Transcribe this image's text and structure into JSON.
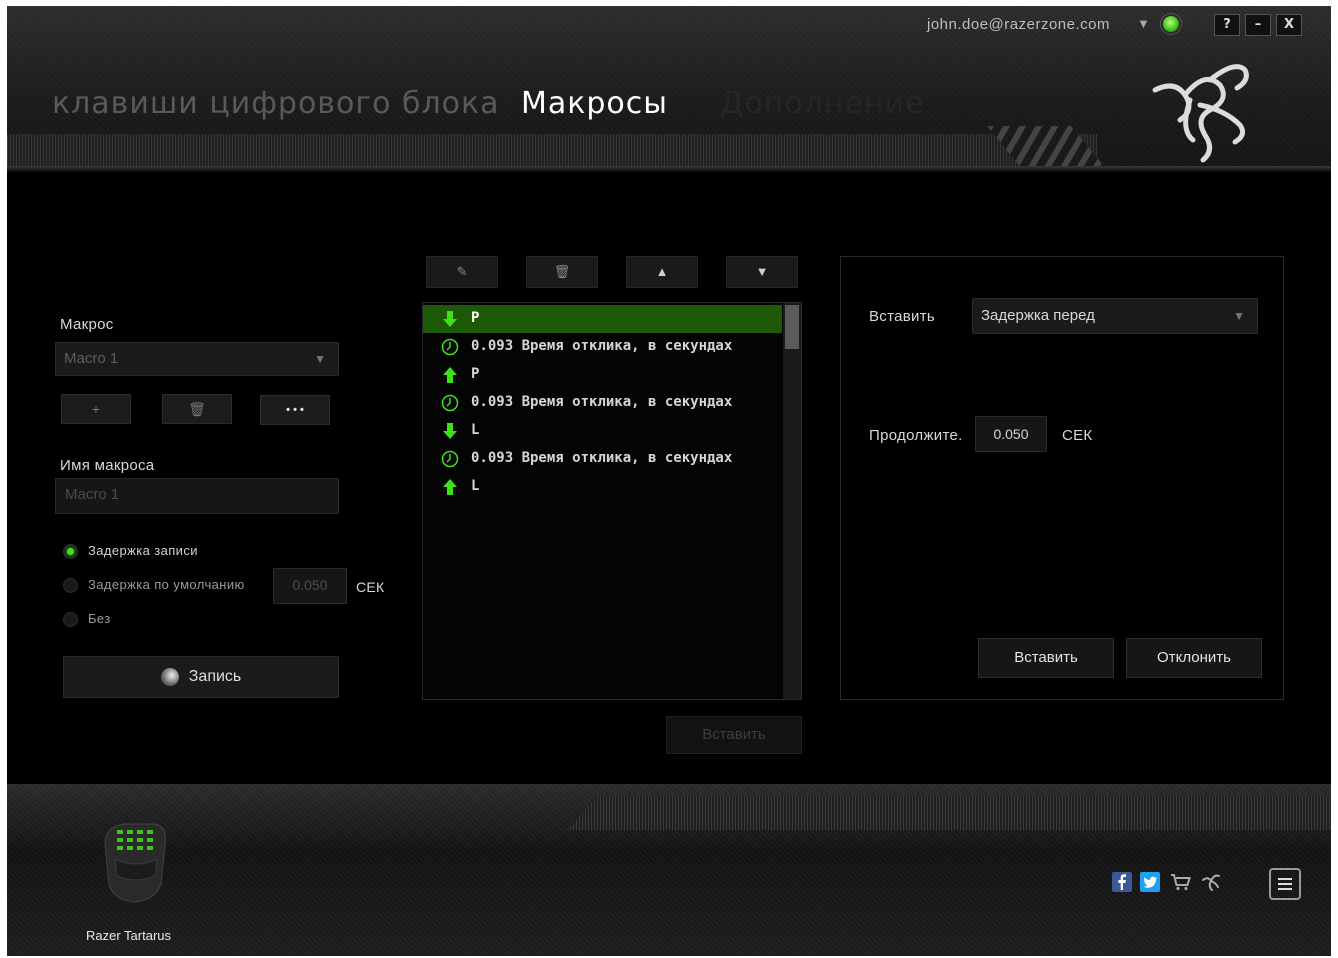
{
  "header": {
    "user_email": "john.doe@razerzone.com",
    "window_buttons": {
      "help": "?",
      "minimize": "–",
      "close": "X"
    },
    "tabs": [
      {
        "label": "клавиши цифрового блока",
        "state": "inactive"
      },
      {
        "label": "Макросы",
        "state": "active"
      },
      {
        "label": "Дополнение",
        "state": "disabled"
      }
    ],
    "logo_icon": "razer-snake-logo"
  },
  "macro_panel": {
    "macro_label": "Макрос",
    "macro_select_value": "Macro 1",
    "add_button": "+",
    "delete_button_icon": "trash-icon",
    "more_button": "• • •",
    "macro_name_label": "Имя макроса",
    "macro_name_placeholder": "Macro 1",
    "delay_options": [
      {
        "label": "Задержка записи",
        "selected": true
      },
      {
        "label": "Задержка по умолчанию",
        "selected": false
      },
      {
        "label": "Без",
        "selected": false
      }
    ],
    "default_delay_value": "0.050",
    "default_delay_unit": "СЕК",
    "record_button": "Запись"
  },
  "event_list": {
    "toolbar_icons": [
      "edit-icon",
      "trash-icon",
      "move-up-icon",
      "move-down-icon"
    ],
    "rows": [
      {
        "type": "key-down",
        "text": "P",
        "selected": true
      },
      {
        "type": "delay",
        "text": "0.093 Время отклика, в секундах",
        "selected": false
      },
      {
        "type": "key-up",
        "text": "P",
        "selected": false
      },
      {
        "type": "delay",
        "text": "0.093 Время отклика, в секундах",
        "selected": false
      },
      {
        "type": "key-down",
        "text": "L",
        "selected": false
      },
      {
        "type": "delay",
        "text": "0.093 Время отклика, в секундах",
        "selected": false
      },
      {
        "type": "key-up",
        "text": "L",
        "selected": false
      }
    ],
    "insert_button": "Вставить"
  },
  "insert_panel": {
    "insert_label": "Вставить",
    "insert_select_value": "Задержка перед",
    "duration_label": "Продолжите.",
    "duration_value": "0.050",
    "duration_unit": "СЕК",
    "insert_button": "Вставить",
    "cancel_button": "Отклонить"
  },
  "footer": {
    "device_name": "Razer Tartarus",
    "social_icons": [
      "facebook-icon",
      "twitter-icon",
      "store-icon",
      "razer-insider-icon"
    ],
    "menu_icon": "hamburger-menu-icon"
  },
  "colors": {
    "accent_green": "#3fe21a",
    "selected_row": "#1d5a08",
    "background": "#000000"
  }
}
